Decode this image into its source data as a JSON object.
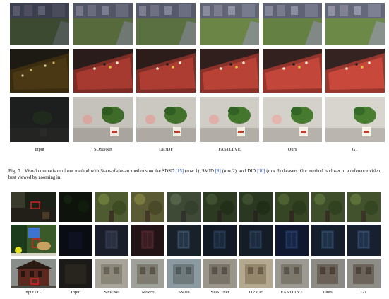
{
  "figure_top": {
    "column_labels": [
      "Input",
      "SDSDNet",
      "DP3DF",
      "FASTLLVE",
      "Ours",
      "GT"
    ],
    "rows": [
      {
        "scene": "yard",
        "brightness": [
          0.55,
          0.75,
          0.8,
          0.95,
          0.9,
          1.0
        ]
      },
      {
        "scene": "pool",
        "brightness": [
          0.35,
          0.85,
          0.85,
          0.9,
          0.95,
          1.0
        ]
      },
      {
        "scene": "plant",
        "brightness": [
          0.2,
          0.85,
          0.9,
          0.95,
          0.95,
          1.0
        ]
      }
    ]
  },
  "caption": {
    "fig_number": "Fig. 7.",
    "text_1": "Visual comparison of our method with State-of-the-art methods on the SDSD ",
    "ref_1": "[15]",
    "text_2": " (row 1), SMID ",
    "ref_2": "[8]",
    "text_3": " (row 2), and DID ",
    "ref_3": "[10]",
    "text_4": " (row 3) datasets. Our method is closer to a reference video, best viewed by zooming in."
  },
  "figure_bottom": {
    "column_labels": [
      "Input / GT",
      "Input",
      "SNRNet",
      "NeRco",
      "SMID",
      "SDSDNet",
      "DP3DF",
      "FASTLLVE",
      "Ours",
      "GT"
    ],
    "rows": [
      {
        "scene": "trees"
      },
      {
        "scene": "room"
      },
      {
        "scene": "building"
      }
    ]
  },
  "colors": {
    "highlight_box": "#e02020",
    "ref_link": "#1a4fd8"
  }
}
